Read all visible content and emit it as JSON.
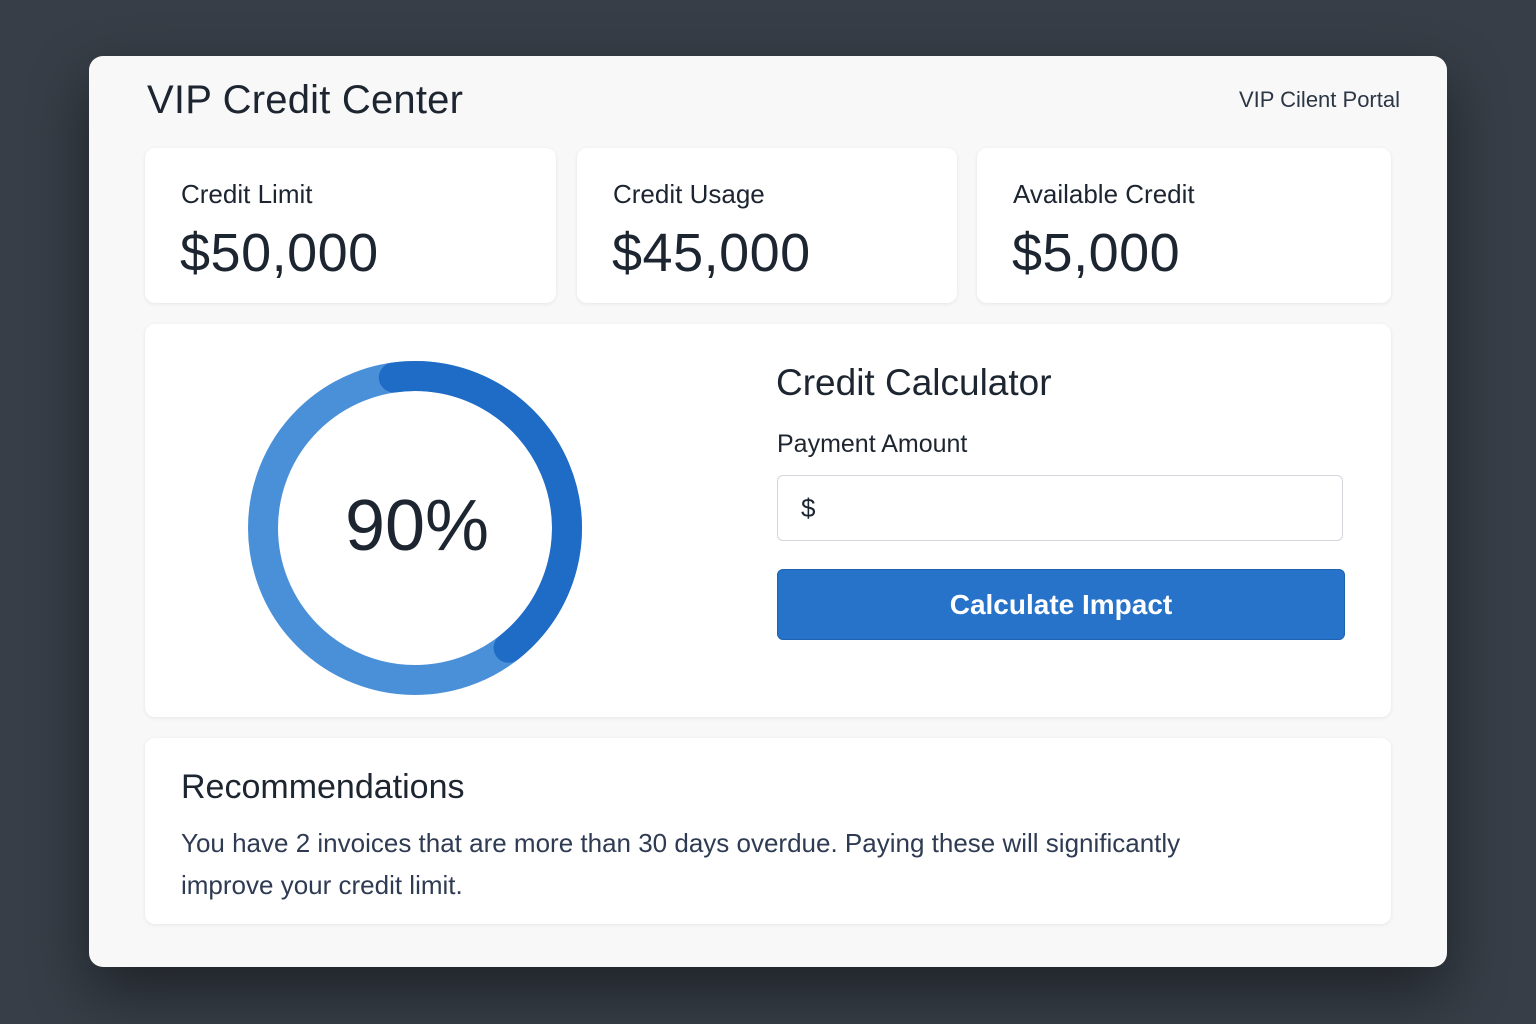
{
  "header": {
    "title": "VIP Credit Center",
    "portal_label": "VIP Cilent Portal"
  },
  "stats": [
    {
      "label": "Credit Limit",
      "value": "$50,000"
    },
    {
      "label": "Credit Usage",
      "value": "$45,000"
    },
    {
      "label": "Available Credit",
      "value": "$5,000"
    }
  ],
  "gauge": {
    "percent_label": "90%",
    "fraction": 0.9,
    "track_color": "#4a90d9",
    "fill_color": "#1f6cc6"
  },
  "calculator": {
    "title": "Credit Calculator",
    "field_label": "Payment Amount",
    "currency_symbol": "$",
    "amount_value": "",
    "button_label": "Calculate Impact"
  },
  "recommendations": {
    "title": "Recommendations",
    "text": "You have 2 invoices that are more than 30 days overdue. Paying these will significantly improve your credit limit."
  },
  "colors": {
    "background": "#373e47",
    "accent": "#2673c9"
  }
}
